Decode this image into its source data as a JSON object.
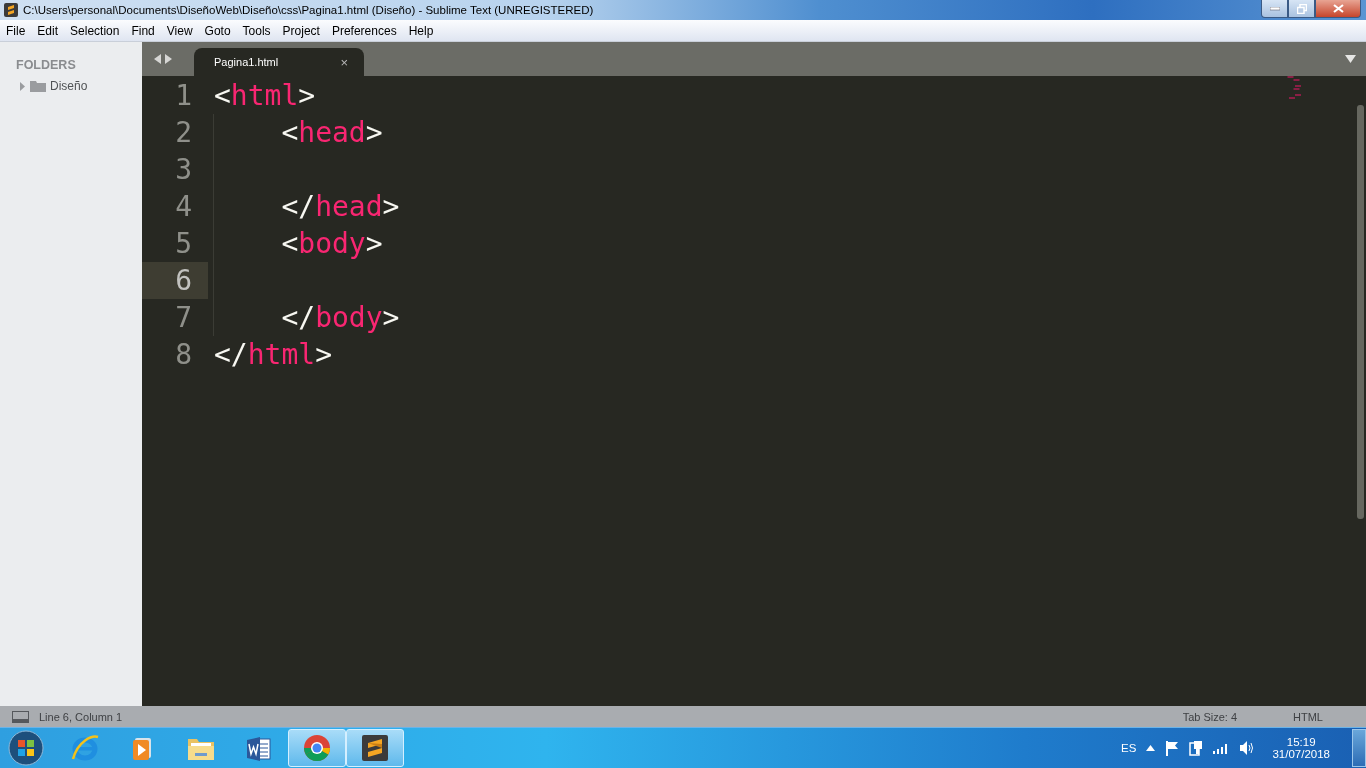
{
  "window": {
    "title": "C:\\Users\\personal\\Documents\\DiseñoWeb\\Diseño\\css\\Pagina1.html (Diseño) - Sublime Text (UNREGISTERED)"
  },
  "menu": [
    "File",
    "Edit",
    "Selection",
    "Find",
    "View",
    "Goto",
    "Tools",
    "Project",
    "Preferences",
    "Help"
  ],
  "sidebar": {
    "heading": "FOLDERS",
    "items": [
      {
        "label": "Diseño",
        "expanded": false
      }
    ]
  },
  "tabs": [
    {
      "label": "Pagina1.html",
      "selected": true,
      "close": "×"
    }
  ],
  "editor": {
    "lines": [
      {
        "number": "1",
        "current": false,
        "tokens": [
          {
            "kind": "punct",
            "text": "<"
          },
          {
            "kind": "tag",
            "text": "html"
          },
          {
            "kind": "punct",
            "text": ">"
          }
        ]
      },
      {
        "number": "2",
        "current": false,
        "tokens": [
          {
            "kind": "punct",
            "text": "    <"
          },
          {
            "kind": "tag",
            "text": "head"
          },
          {
            "kind": "punct",
            "text": ">"
          }
        ]
      },
      {
        "number": "3",
        "current": false
      },
      {
        "number": "4",
        "current": false,
        "tokens": [
          {
            "kind": "punct",
            "text": "    </"
          },
          {
            "kind": "tag",
            "text": "head"
          },
          {
            "kind": "punct",
            "text": ">"
          }
        ]
      },
      {
        "number": "5",
        "current": false,
        "tokens": [
          {
            "kind": "punct",
            "text": "    <"
          },
          {
            "kind": "tag",
            "text": "body"
          },
          {
            "kind": "punct",
            "text": ">"
          }
        ]
      },
      {
        "number": "6",
        "current": true
      },
      {
        "number": "7",
        "current": false,
        "tokens": [
          {
            "kind": "punct",
            "text": "    </"
          },
          {
            "kind": "tag",
            "text": "body"
          },
          {
            "kind": "punct",
            "text": ">"
          }
        ]
      },
      {
        "number": "8",
        "current": false,
        "tokens": [
          {
            "kind": "punct",
            "text": "</"
          },
          {
            "kind": "tag",
            "text": "html"
          },
          {
            "kind": "punct",
            "text": ">"
          }
        ]
      }
    ]
  },
  "status_bar": {
    "position": "Line 6, Column 1",
    "tab_size": "Tab Size: 4",
    "syntax": "HTML"
  },
  "taskbar": {
    "apps": [
      {
        "kind": "browser-e",
        "running": false
      },
      {
        "kind": "player",
        "running": false
      },
      {
        "kind": "folder",
        "running": false
      },
      {
        "kind": "word",
        "running": false
      },
      {
        "kind": "chrome",
        "running": true
      },
      {
        "kind": "sublime",
        "running": true
      }
    ],
    "tray": {
      "language": "ES",
      "time": "15:19",
      "date": "31/07/2018"
    }
  }
}
